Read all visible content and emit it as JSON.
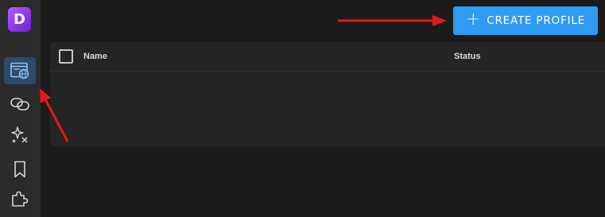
{
  "app": {
    "logo_letter": "D",
    "accent_color": "#2f9bf2",
    "logo_color": "#9b45f0"
  },
  "sidebar": {
    "items": [
      {
        "icon": "browser-globe-icon",
        "active": true
      },
      {
        "icon": "link-icon",
        "active": false
      },
      {
        "icon": "sparkle-icon",
        "active": false
      },
      {
        "icon": "bookmark-icon",
        "active": false
      },
      {
        "icon": "puzzle-icon",
        "active": false
      }
    ]
  },
  "toolbar": {
    "create_label": "CREATE PROFILE",
    "create_icon": "plus-icon"
  },
  "table": {
    "columns": [
      "Name",
      "Status"
    ],
    "rows": []
  },
  "annotations": {
    "arrow_color": "#e01b1b"
  }
}
